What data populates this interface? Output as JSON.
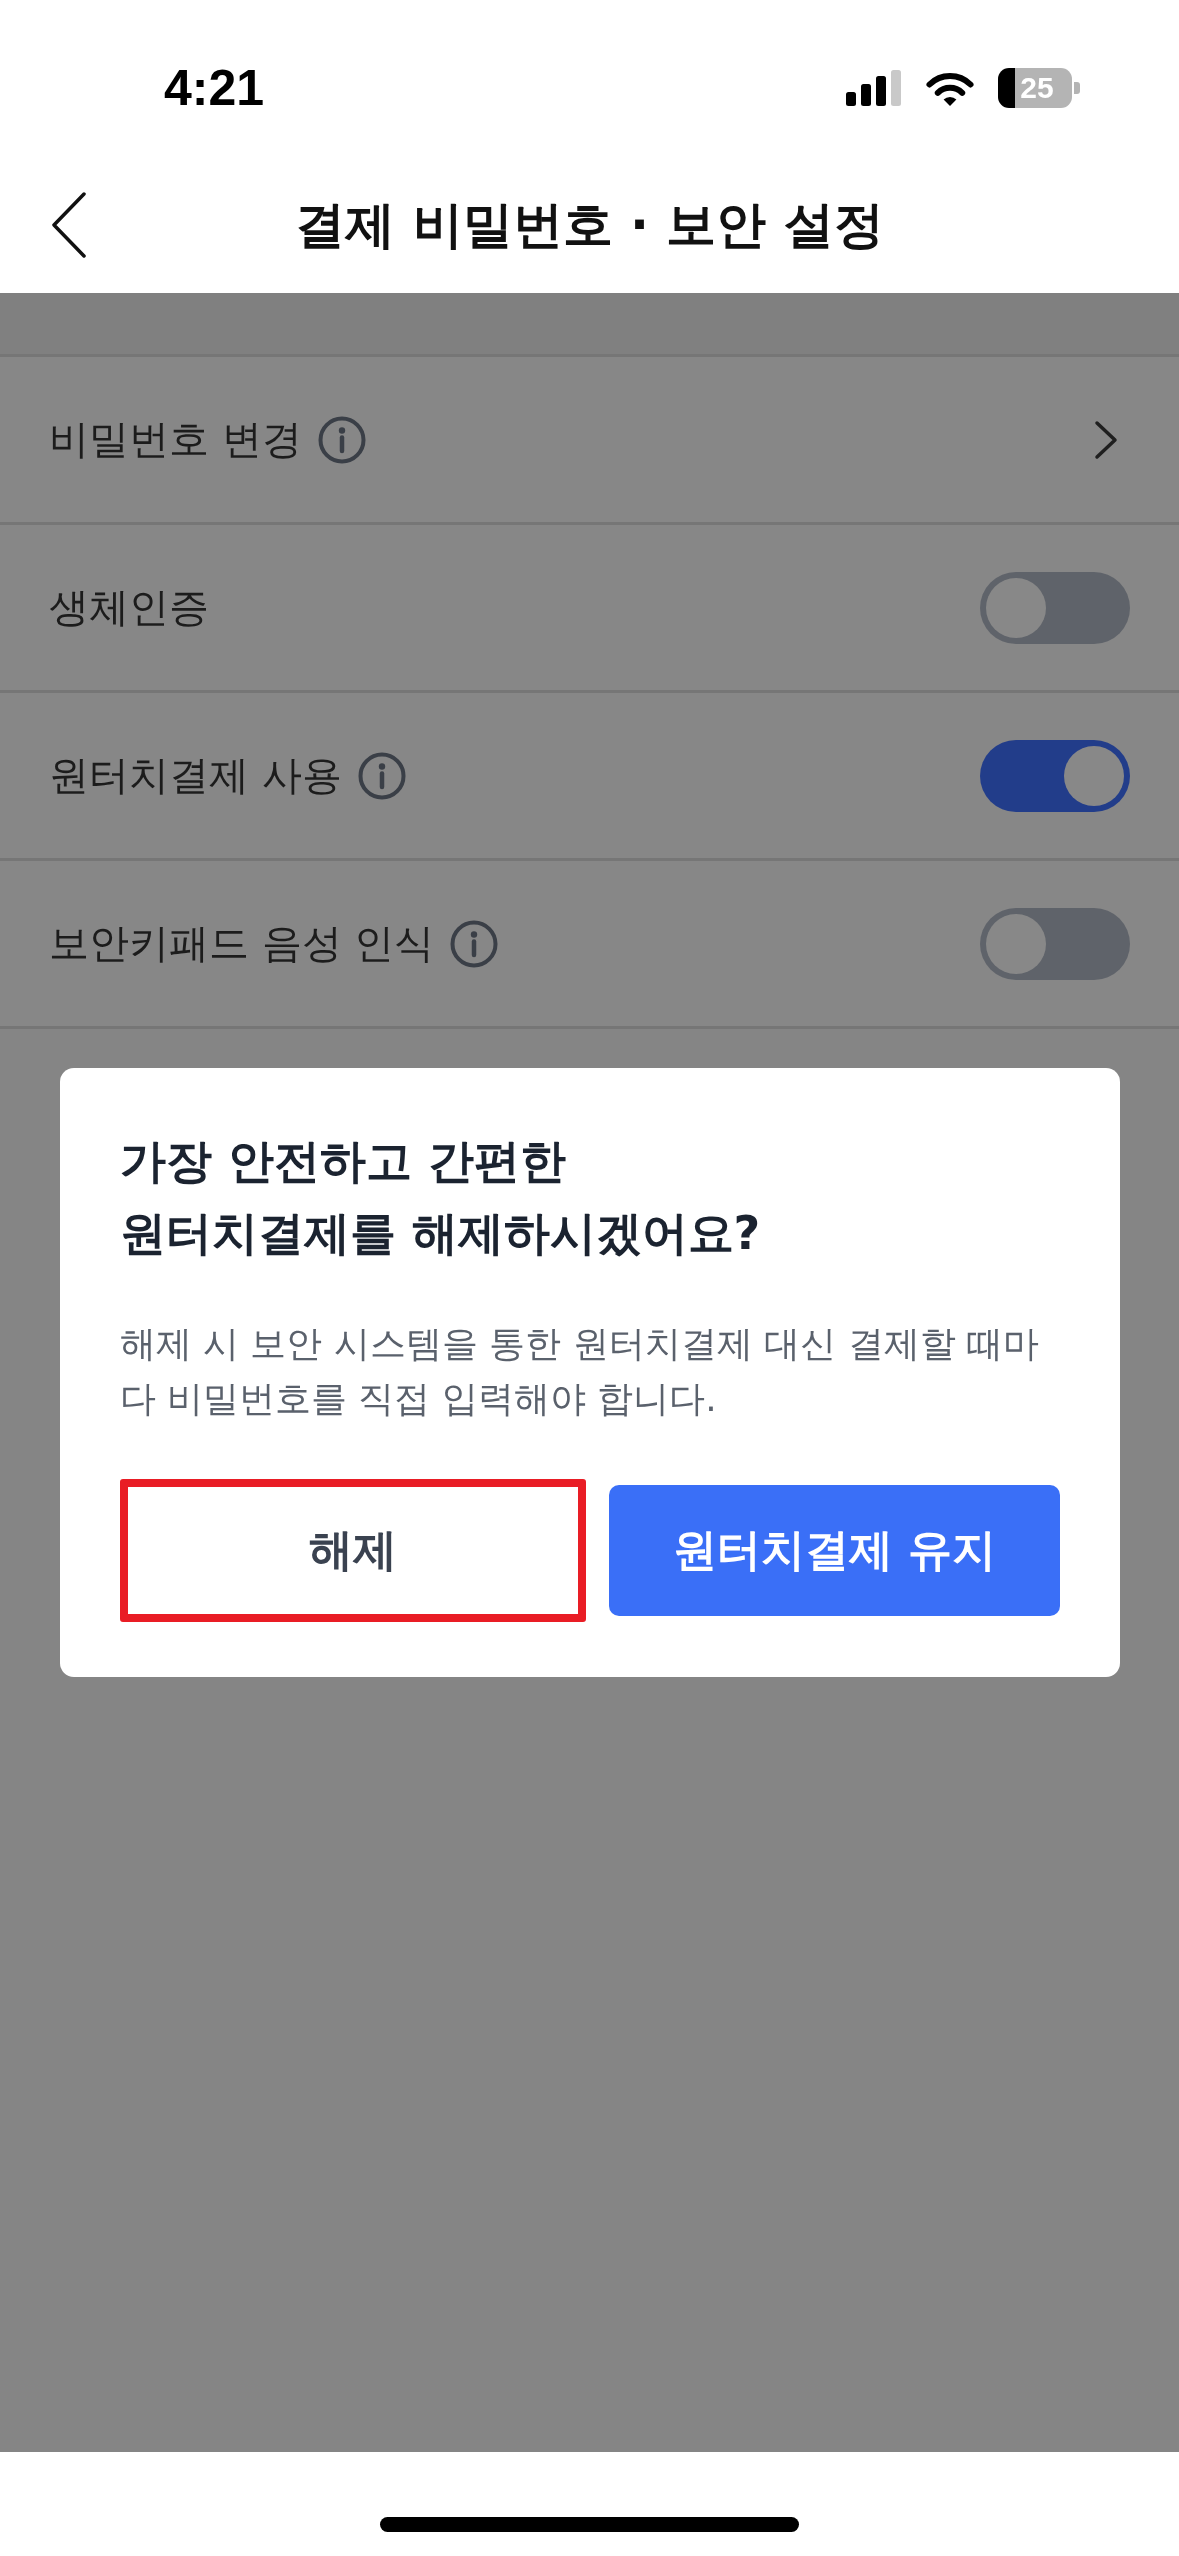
{
  "status_bar": {
    "time": "4:21",
    "battery": "25"
  },
  "header": {
    "title": "결제 비밀번호 · 보안 설정"
  },
  "settings": [
    {
      "kind": "link",
      "label": "비밀번호 변경",
      "info": true
    },
    {
      "kind": "toggle",
      "label": "생체인증",
      "info": false,
      "on": false
    },
    {
      "kind": "toggle",
      "label": "원터치결제 사용",
      "info": true,
      "on": true
    },
    {
      "kind": "toggle",
      "label": "보안키패드 음성 인식",
      "info": true,
      "on": false
    }
  ],
  "dialog": {
    "title": "가장 안전하고 간편한\n원터치결제를 해제하시겠어요?",
    "message": "해제 시 보안 시스템을 통한 원터치결제 대신 결제할 때마다 비밀번호를 직접 입력해야 합니다.",
    "buttons": [
      {
        "kind": "secondary",
        "label": "해제",
        "highlighted": true
      },
      {
        "kind": "primary",
        "label": "원터치결제 유지",
        "highlighted": false
      }
    ]
  }
}
